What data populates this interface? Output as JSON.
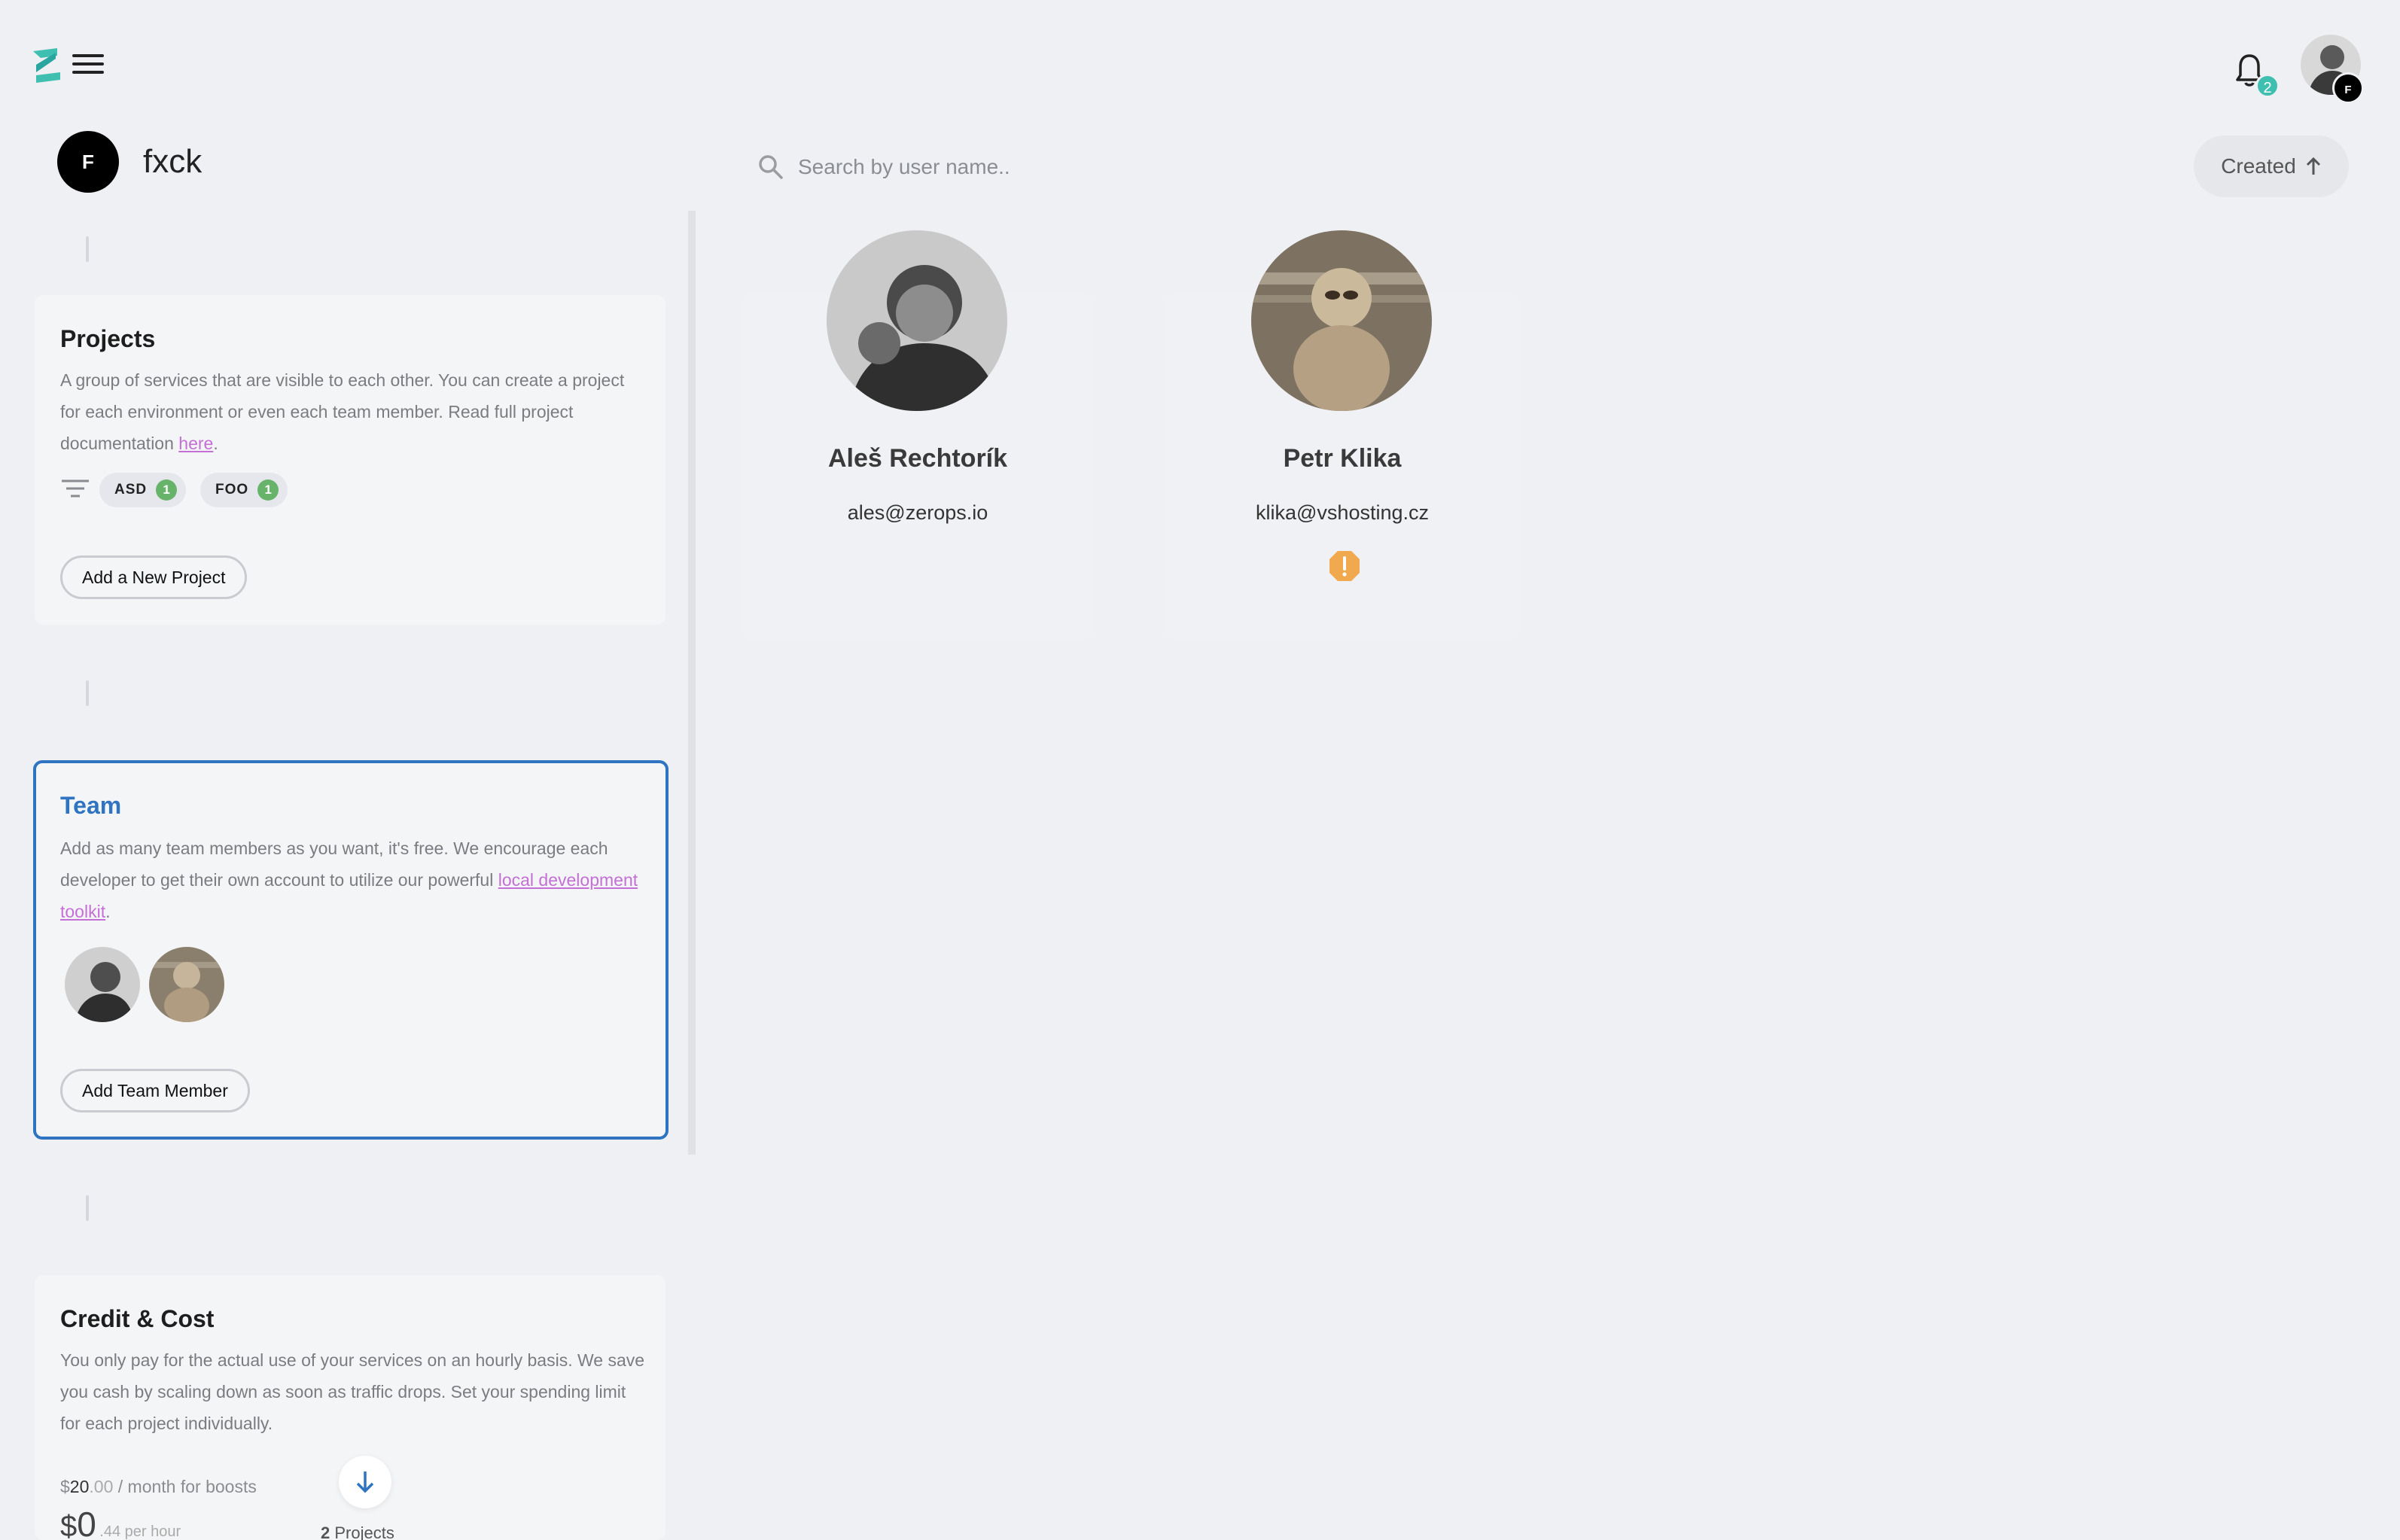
{
  "header": {
    "notifications_count": "2",
    "user_badge": "F"
  },
  "org": {
    "initial": "F",
    "name": "fxck"
  },
  "search": {
    "placeholder": "Search by user name.."
  },
  "sort": {
    "label": "Created"
  },
  "projects": {
    "title": "Projects",
    "desc_pre": "A group of services that are visible to each other. You can create a project for each environment or even each team member. Read full project documentation ",
    "desc_link": "here",
    "desc_post": ".",
    "tags": [
      {
        "label": "ASD",
        "count": "1"
      },
      {
        "label": "FOO",
        "count": "1"
      }
    ],
    "add_button": "Add a New Project"
  },
  "team": {
    "title": "Team",
    "desc_pre": "Add as many team members as you want, it's free. We encourage each developer to get their own account to utilize our powerful ",
    "desc_link": "local development toolkit",
    "desc_post": ".",
    "add_button": "Add Team Member"
  },
  "credit": {
    "title": "Credit & Cost",
    "desc": "You only pay for the actual use of your services on an hourly basis. We save you cash by scaling down as soon as traffic drops. Set your spending limit for each project individually.",
    "boost_currency": "$",
    "boost_amount": "20",
    "boost_decimals": ".00",
    "boost_suffix": " / month for boosts",
    "cost_currency": "$",
    "cost_amount": "0",
    "cost_decimals": ".44 per hour",
    "projects_count": "2",
    "projects_label": "Projects"
  },
  "members": [
    {
      "name": "Aleš Rechtorík",
      "email": "ales@zerops.io",
      "warning": false
    },
    {
      "name": "Petr Klika",
      "email": "klika@vshosting.cz",
      "warning": true
    }
  ],
  "colors": {
    "accent": "#2f74c0",
    "link": "#c46fd6",
    "badge": "#3fbfb0",
    "tag_count": "#67b36a",
    "warning": "#f0a94f"
  }
}
